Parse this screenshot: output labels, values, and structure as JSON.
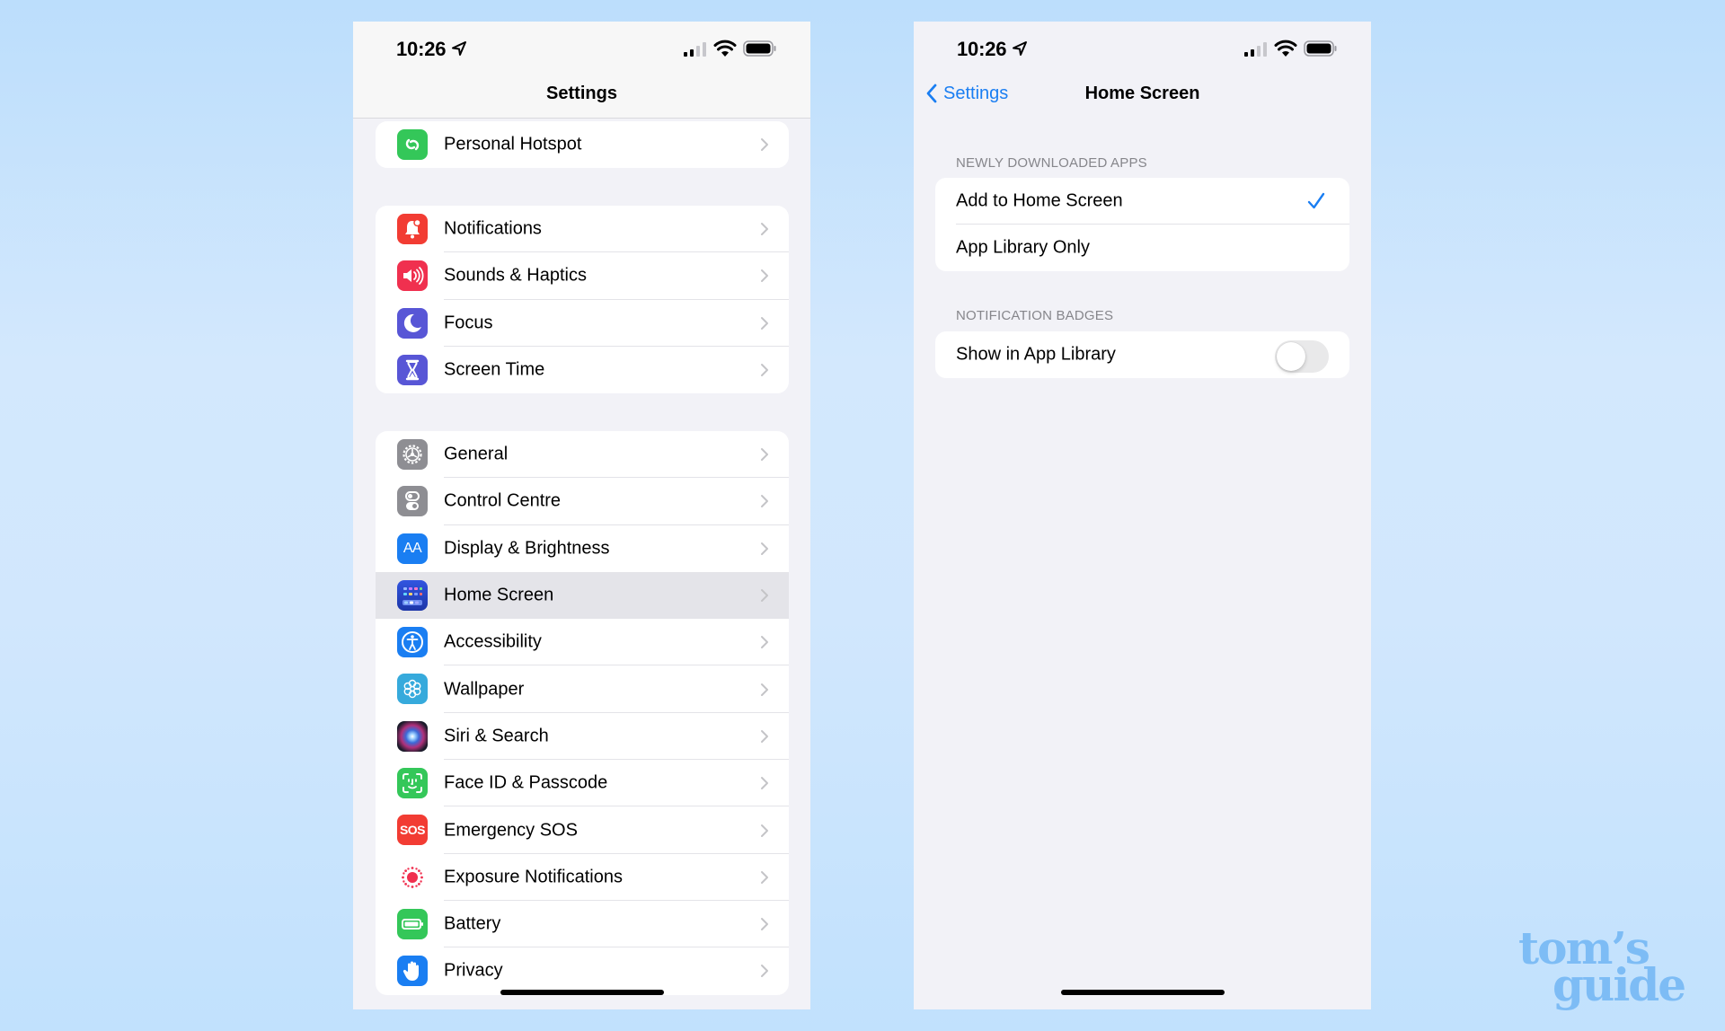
{
  "colors": {
    "ios_blue": "#1a7ef2",
    "selected_row": "#e4e4e9",
    "background": "#f2f2f7",
    "brand_logo": "#7dbcf5"
  },
  "left_screen": {
    "status_bar": {
      "time": "10:26",
      "icons": [
        "location-arrow-icon",
        "signal-icon",
        "wifi-icon",
        "battery-icon"
      ]
    },
    "nav_title": "Settings",
    "groups": [
      {
        "items": [
          {
            "label": "Personal Hotspot",
            "icon": "personal-hotspot-icon",
            "color": "#34c759"
          }
        ]
      },
      {
        "items": [
          {
            "label": "Notifications",
            "icon": "notifications-icon",
            "color": "#f23c33"
          },
          {
            "label": "Sounds & Haptics",
            "icon": "sounds-icon",
            "color": "#f0304f"
          },
          {
            "label": "Focus",
            "icon": "focus-moon-icon",
            "color": "#5856d6"
          },
          {
            "label": "Screen Time",
            "icon": "screen-time-hourglass-icon",
            "color": "#5856d6"
          }
        ]
      },
      {
        "items": [
          {
            "label": "General",
            "icon": "general-gear-icon",
            "color": "#8e8e93"
          },
          {
            "label": "Control Centre",
            "icon": "control-centre-icon",
            "color": "#8e8e93"
          },
          {
            "label": "Display & Brightness",
            "icon": "display-brightness-icon",
            "color": "#1a7ef2",
            "icon_text": "AA"
          },
          {
            "label": "Home Screen",
            "icon": "home-screen-icon",
            "color": "#2546c8",
            "selected": true
          },
          {
            "label": "Accessibility",
            "icon": "accessibility-icon",
            "color": "#1a7ef2"
          },
          {
            "label": "Wallpaper",
            "icon": "wallpaper-icon",
            "color": "#36aadc"
          },
          {
            "label": "Siri & Search",
            "icon": "siri-icon",
            "color": "#1c1c2e"
          },
          {
            "label": "Face ID & Passcode",
            "icon": "face-id-icon",
            "color": "#34c759"
          },
          {
            "label": "Emergency SOS",
            "icon": "emergency-sos-icon",
            "color": "#f23c33",
            "icon_text": "SOS"
          },
          {
            "label": "Exposure Notifications",
            "icon": "exposure-notifications-icon",
            "color": "#ffffff"
          },
          {
            "label": "Battery",
            "icon": "battery-app-icon",
            "color": "#34c759"
          },
          {
            "label": "Privacy",
            "icon": "privacy-hand-icon",
            "color": "#1a7ef2"
          }
        ]
      }
    ]
  },
  "right_screen": {
    "status_bar": {
      "time": "10:26"
    },
    "back_label": "Settings",
    "nav_title": "Home Screen",
    "sections": [
      {
        "header": "NEWLY DOWNLOADED APPS",
        "options": [
          {
            "label": "Add to Home Screen",
            "checked": true
          },
          {
            "label": "App Library Only",
            "checked": false
          }
        ]
      },
      {
        "header": "NOTIFICATION BADGES",
        "toggle": {
          "label": "Show in App Library",
          "on": false
        }
      }
    ]
  },
  "watermark": {
    "line1": "tom’s",
    "line2": "guide"
  }
}
